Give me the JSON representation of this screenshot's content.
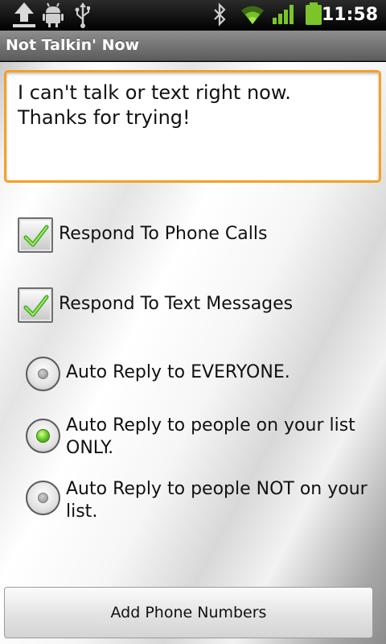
{
  "status_bar": {
    "time": "11:58",
    "left_icons": [
      "upload-icon",
      "android-debug-icon",
      "usb-icon"
    ],
    "right_icons": [
      "bluetooth-icon",
      "wifi-icon",
      "signal-icon",
      "battery-icon"
    ]
  },
  "app": {
    "title": "Not Talkin' Now"
  },
  "message": {
    "value": "I can't talk or text right now.\nThanks for trying!",
    "accent_color": "#f5a023"
  },
  "options": {
    "respond_calls": {
      "label": "Respond To Phone Calls",
      "checked": true
    },
    "respond_texts": {
      "label": "Respond To Text Messages",
      "checked": true
    }
  },
  "reply_mode": {
    "options": [
      {
        "label": "Auto Reply to EVERYONE.",
        "selected": false
      },
      {
        "label": "Auto Reply to people on your list ONLY.",
        "selected": true
      },
      {
        "label": "Auto Reply to people NOT on your list.",
        "selected": false
      }
    ]
  },
  "buttons": {
    "add_phone_numbers": "Add Phone Numbers"
  }
}
